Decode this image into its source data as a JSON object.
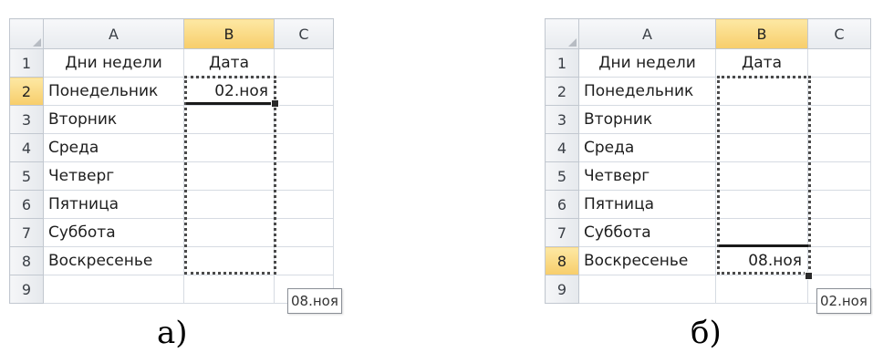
{
  "panels": [
    {
      "caption": "а)",
      "columns": [
        "A",
        "B",
        "C"
      ],
      "rows": [
        "1",
        "2",
        "3",
        "4",
        "5",
        "6",
        "7",
        "8",
        "9"
      ],
      "cells": {
        "A1": "Дни недели",
        "B1": "Дата",
        "A2": "Понедельник",
        "B2": "02.ноя",
        "A3": "Вторник",
        "A4": "Среда",
        "A5": "Четверг",
        "A6": "Пятница",
        "A7": "Суббота",
        "A8": "Воскресенье"
      },
      "active_cell": "B2",
      "fill_tooltip": "08.ноя"
    },
    {
      "caption": "б)",
      "columns": [
        "A",
        "B",
        "C"
      ],
      "rows": [
        "1",
        "2",
        "3",
        "4",
        "5",
        "6",
        "7",
        "8",
        "9"
      ],
      "cells": {
        "A1": "Дни недели",
        "B1": "Дата",
        "A2": "Понедельник",
        "A3": "Вторник",
        "A4": "Среда",
        "A5": "Четверг",
        "A6": "Пятница",
        "A7": "Суббота",
        "A8": "Воскресенье",
        "B8": "08.ноя"
      },
      "active_cell": "B8",
      "fill_tooltip": "02.ноя"
    }
  ],
  "colors": {
    "selected_header": "#f7cd6a",
    "grid_line": "#d6dbe2",
    "header_bg": "#e8ebef"
  }
}
